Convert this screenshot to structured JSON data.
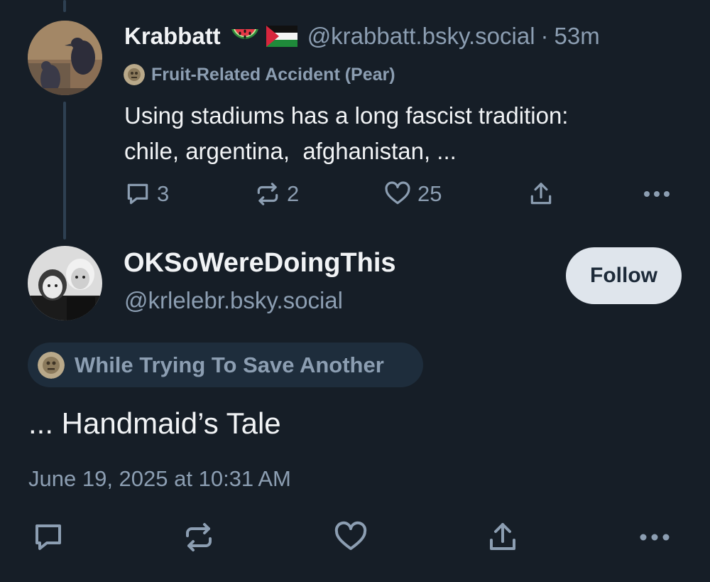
{
  "parent_post": {
    "display_name": "Krabbatt",
    "emojis": [
      "watermelon-emoji",
      "palestine-flag-emoji"
    ],
    "handle": "@krabbatt.bsky.social",
    "separator": "·",
    "time_ago": "53m",
    "label": "Fruit-Related Accident (Pear)",
    "text_lines": [
      "Using stadiums has a long fascist tradition:",
      "chile, argentina,  afghanistan, ..."
    ],
    "actions": {
      "reply_count": "3",
      "repost_count": "2",
      "like_count": "25"
    }
  },
  "reply_post": {
    "display_name": "OKSoWereDoingThis",
    "handle": "@krlelebr.bsky.social",
    "follow_label": "Follow",
    "label": "While Trying To Save Another",
    "text": "... Handmaid’s Tale",
    "timestamp": "June 19, 2025 at 10:31 AM"
  },
  "colors": {
    "background": "#161e27",
    "text_primary": "#f1f3f5",
    "text_secondary": "#8c9eb2",
    "thread_line": "#2e4052",
    "follow_button_bg": "#dfe5ec",
    "label_pill_bg": "#1e2d3c"
  },
  "icons": [
    "comment-icon",
    "repost-icon",
    "heart-icon",
    "share-icon",
    "more-icon"
  ]
}
